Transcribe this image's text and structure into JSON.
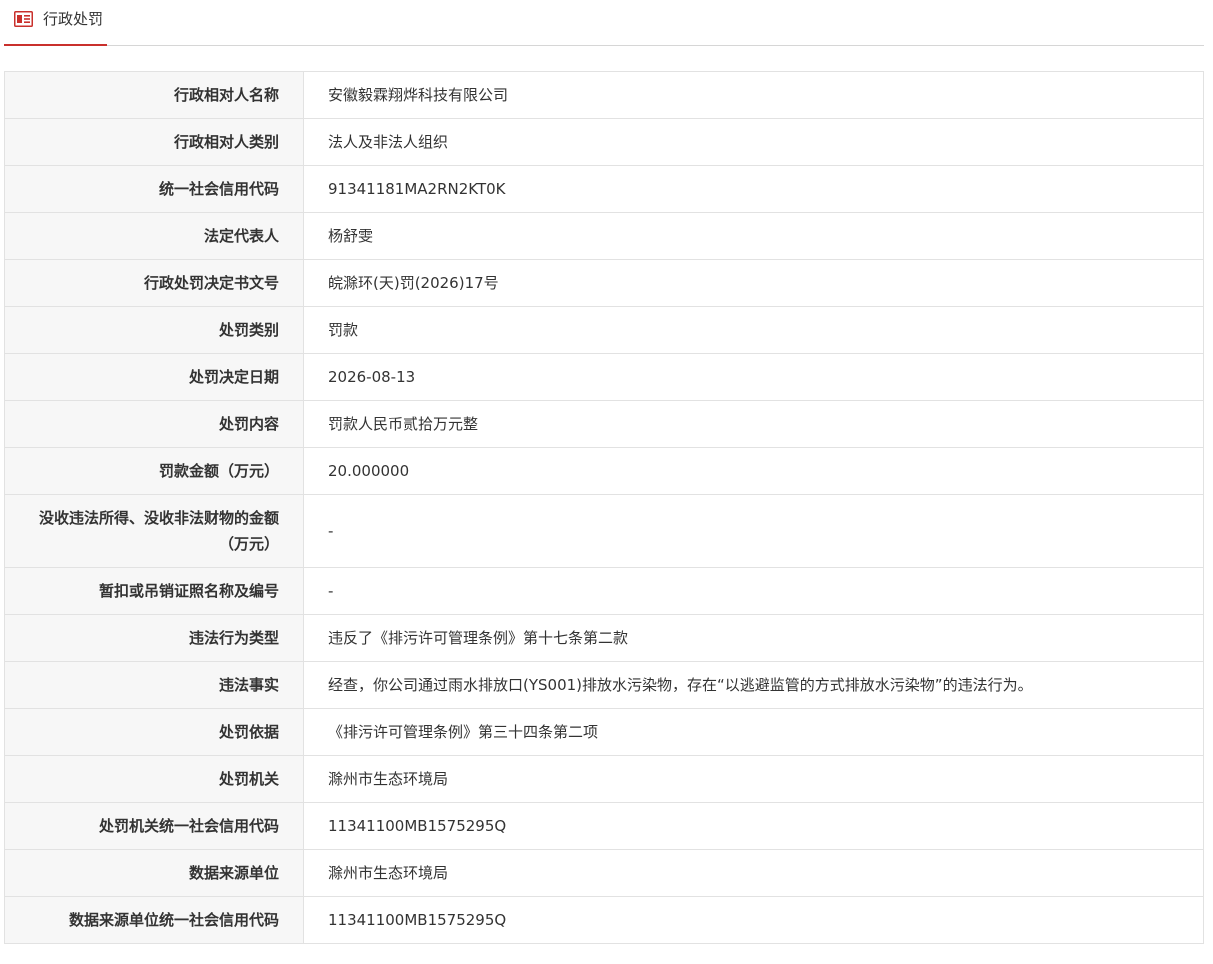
{
  "tab": {
    "label": "行政处罚",
    "icon": "document-list-icon",
    "accent": "#c9302c"
  },
  "rows": [
    {
      "label": "行政相对人名称",
      "value": "安徽毅霖翔烨科技有限公司"
    },
    {
      "label": "行政相对人类别",
      "value": "法人及非法人组织"
    },
    {
      "label": "统一社会信用代码",
      "value": "91341181MA2RN2KT0K"
    },
    {
      "label": "法定代表人",
      "value": "杨舒雯"
    },
    {
      "label": "行政处罚决定书文号",
      "value": "皖滁环(天)罚(2026)17号"
    },
    {
      "label": "处罚类别",
      "value": "罚款"
    },
    {
      "label": "处罚决定日期",
      "value": "2026-08-13"
    },
    {
      "label": "处罚内容",
      "value": "罚款人民币贰拾万元整"
    },
    {
      "label": "罚款金额（万元）",
      "value": "20.000000"
    },
    {
      "label": "没收违法所得、没收非法财物的金额（万元）",
      "value": "-"
    },
    {
      "label": "暂扣或吊销证照名称及编号",
      "value": "-"
    },
    {
      "label": "违法行为类型",
      "value": "违反了《排污许可管理条例》第十七条第二款"
    },
    {
      "label": "违法事实",
      "value": "经查，你公司通过雨水排放口(YS001)排放水污染物，存在“以逃避监管的方式排放水污染物”的违法行为。"
    },
    {
      "label": "处罚依据",
      "value": "《排污许可管理条例》第三十四条第二项"
    },
    {
      "label": "处罚机关",
      "value": "滁州市生态环境局"
    },
    {
      "label": "处罚机关统一社会信用代码",
      "value": "11341100MB1575295Q"
    },
    {
      "label": "数据来源单位",
      "value": "滁州市生态环境局"
    },
    {
      "label": "数据来源单位统一社会信用代码",
      "value": "11341100MB1575295Q"
    }
  ]
}
